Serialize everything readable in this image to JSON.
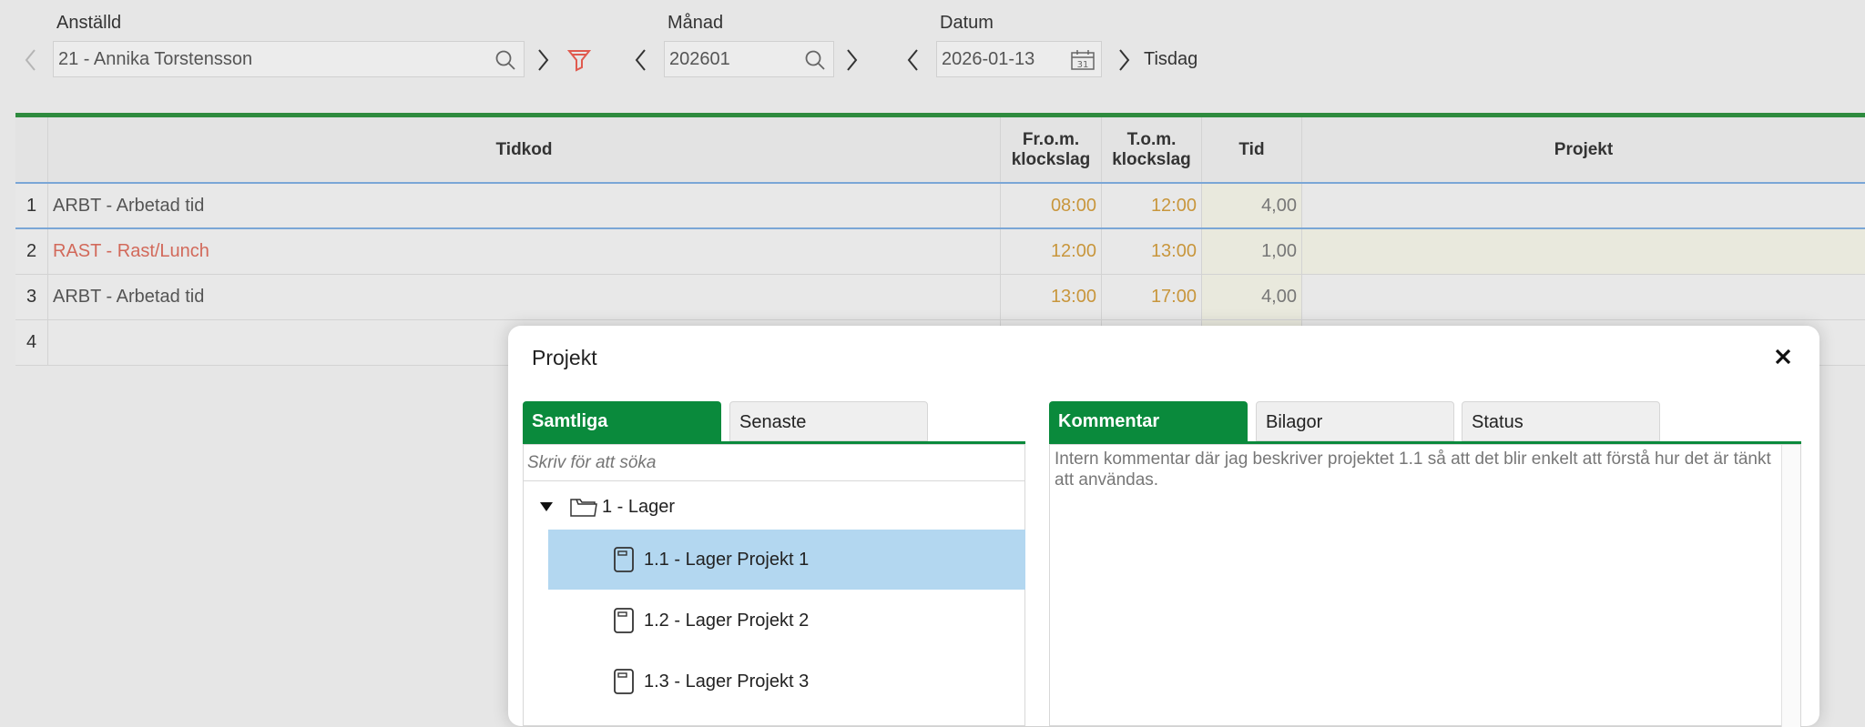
{
  "header": {
    "employee": {
      "label": "Anställd",
      "value": "21 - Annika Torstensson"
    },
    "month": {
      "label": "Månad",
      "value": "202601"
    },
    "date": {
      "label": "Datum",
      "value": "2026-01-13",
      "weekday": "Tisdag"
    }
  },
  "grid": {
    "columns": {
      "tidkod": "Tidkod",
      "from": "Fr.o.m. klockslag",
      "tom": "T.o.m. klockslag",
      "tid": "Tid",
      "projekt": "Projekt"
    },
    "rows": [
      {
        "num": "1",
        "tidkod": "ARBT - Arbetad tid",
        "from": "08:00",
        "tom": "12:00",
        "tid": "4,00",
        "projekt": ""
      },
      {
        "num": "2",
        "tidkod": "RAST - Rast/Lunch",
        "from": "12:00",
        "tom": "13:00",
        "tid": "1,00",
        "projekt": ""
      },
      {
        "num": "3",
        "tidkod": "ARBT - Arbetad tid",
        "from": "13:00",
        "tom": "17:00",
        "tid": "4,00",
        "projekt": ""
      },
      {
        "num": "4",
        "tidkod": "",
        "from": "",
        "tom": "",
        "tid": "",
        "projekt": ""
      }
    ]
  },
  "modal": {
    "title": "Projekt",
    "close_icon": "close-icon",
    "left_tabs": [
      "Samtliga",
      "Senaste"
    ],
    "search_placeholder": "Skriv för att söka",
    "tree": {
      "folder": "1 - Lager",
      "items": [
        "1.1 - Lager Projekt 1",
        "1.2 - Lager Projekt 2",
        "1.3 - Lager Projekt 3"
      ],
      "selected_index": 0
    },
    "right_tabs": [
      "Kommentar",
      "Bilagor",
      "Status"
    ],
    "comment": "Intern kommentar där jag beskriver projektet 1.1 så att det blir enkelt att förstå hur det är tänkt att användas."
  },
  "colors": {
    "accent": "#0a8a3c",
    "time_text": "#c8963c",
    "rast_text": "#d2695a",
    "selected_row": "#b3d7f0"
  }
}
